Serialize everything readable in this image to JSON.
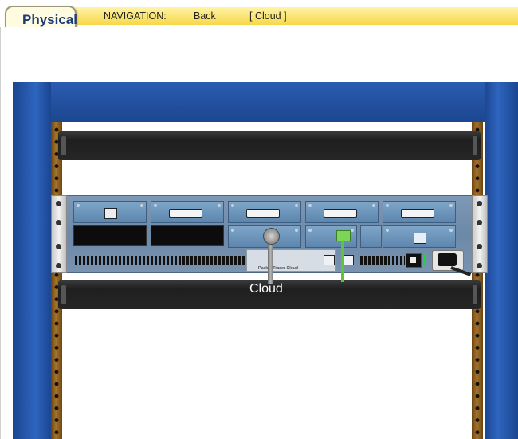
{
  "tab": {
    "label": "Physical"
  },
  "nav": {
    "label": "NAVIGATION:",
    "back": "Back",
    "location": "[ Cloud ]"
  },
  "device": {
    "name": "Cloud",
    "brand": "Packet Tracer Cloud"
  },
  "colors": {
    "nav_strip": "#f6d84a",
    "rack_blue": "#1c468f",
    "rail_brown": "#a5732c",
    "cable_green": "#61c33a"
  }
}
